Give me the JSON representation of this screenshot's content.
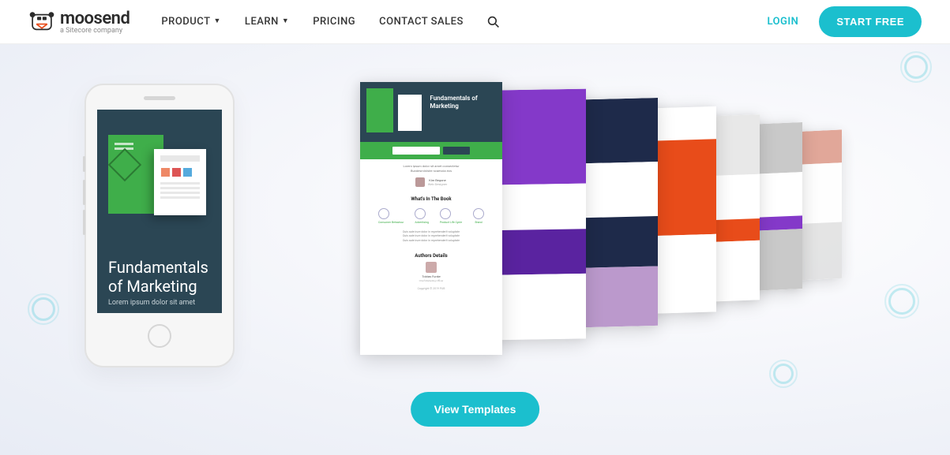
{
  "logo": {
    "text": "moosend",
    "sub": "a Sitecore company"
  },
  "nav": {
    "items": [
      {
        "label": "PRODUCT",
        "dropdown": true
      },
      {
        "label": "LEARN",
        "dropdown": true
      },
      {
        "label": "PRICING",
        "dropdown": false
      },
      {
        "label": "CONTACT SALES",
        "dropdown": false
      }
    ]
  },
  "header": {
    "login": "LOGIN",
    "start_free": "START FREE"
  },
  "phone": {
    "title": "Fundamentals of Marketing",
    "subtitle": "Lorem ipsum dolor sit amet"
  },
  "template": {
    "hero_title": "Fundamentals of Marketing",
    "section_whats": "What's In The Book",
    "section_author": "Authors Details",
    "icon_labels": [
      "Consumer Behaviour",
      "Advertising",
      "Product Life Cycle",
      "Brand"
    ],
    "copyright": "Copyright © 2019 PUB"
  },
  "cta": {
    "view_templates": "View Templates"
  }
}
